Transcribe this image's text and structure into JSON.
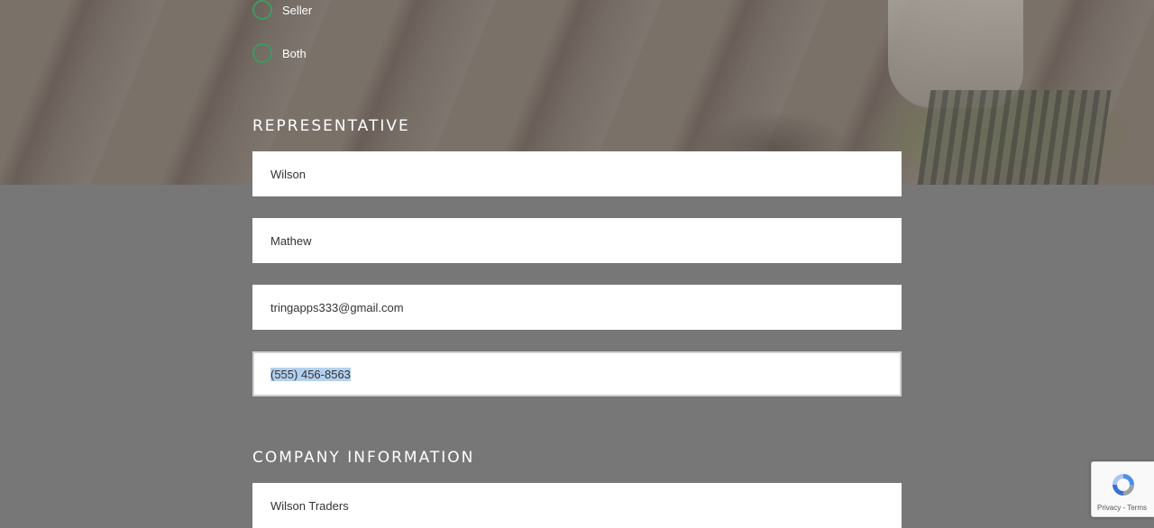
{
  "user_type": {
    "options": [
      {
        "label": "Seller",
        "selected": false
      },
      {
        "label": "Both",
        "selected": false
      }
    ]
  },
  "representative": {
    "title": "REPRESENTATIVE",
    "last_name": "Wilson",
    "first_name": "Mathew",
    "email": "tringapps333@gmail.com",
    "phone": "(555) 456-8563"
  },
  "company": {
    "title": "COMPANY INFORMATION",
    "name": "Wilson Traders"
  },
  "recaptcha": {
    "privacy": "Privacy",
    "separator": " - ",
    "terms": "Terms"
  },
  "colors": {
    "radio_border": "#3e9a63",
    "page_background": "#777777",
    "selection_highlight": "#b3d1ef"
  }
}
